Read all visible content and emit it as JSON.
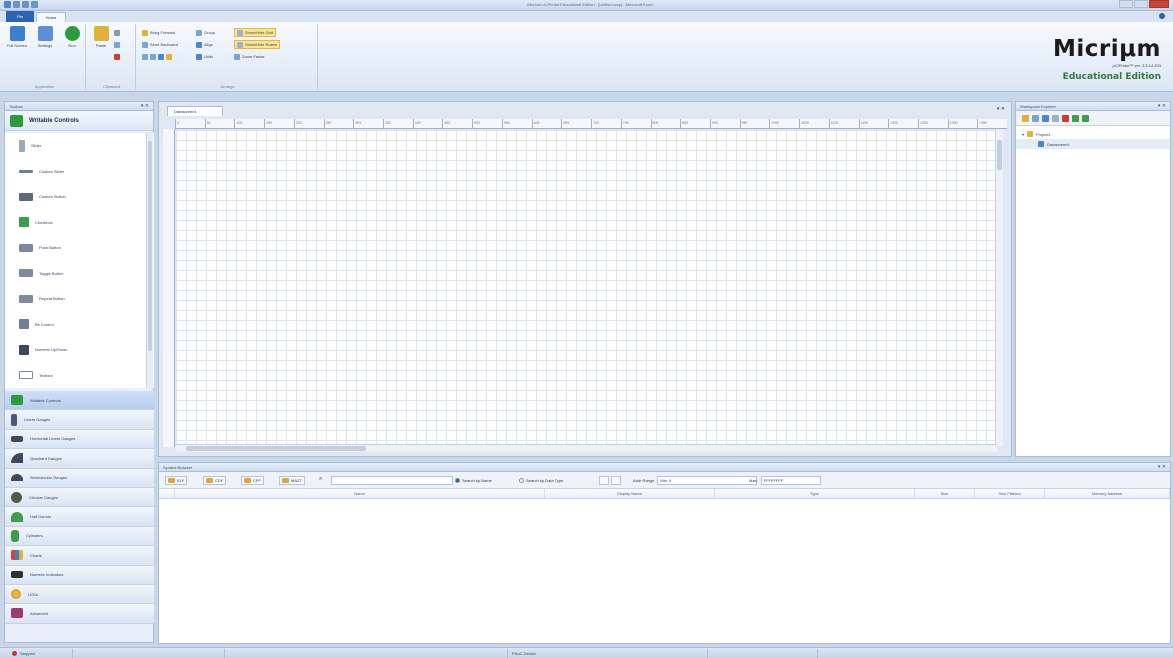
{
  "window": {
    "title": "Micrium uC/Probe Educational Edition - [Untitled.wsp] - Microsoft Excel"
  },
  "ribbon": {
    "tabs": [
      {
        "label": "File"
      },
      {
        "label": "Home"
      }
    ],
    "groups": {
      "application": {
        "label": "Application",
        "full_screen": "Full Screen",
        "settings": "Settings",
        "run": "Run"
      },
      "clipboard": {
        "label": "Clipboard",
        "paste": "Paste"
      },
      "arrange": {
        "label": "Arrange",
        "bring_forward": "Bring Forward",
        "send_backward": "Send Backward",
        "group": "Group",
        "align": "Align",
        "units": "Units",
        "show_grid": "Show/Hide Grid",
        "show_rulers": "Show/Hide Rulers",
        "zoom_factor": "Zoom Factor"
      }
    }
  },
  "brand": {
    "name": "Micriμm",
    "version": "μC/Probe™ ver. 3.5.14.203",
    "edition": "Educational Edition"
  },
  "toolbox": {
    "title": "Toolbox",
    "current_category": "Writable Controls",
    "items": [
      {
        "label": "Slider"
      },
      {
        "label": "Custom Slider"
      },
      {
        "label": "Custom Switch"
      },
      {
        "label": "Checkbox"
      },
      {
        "label": "Push Button"
      },
      {
        "label": "Toggle Button"
      },
      {
        "label": "Repeat Button"
      },
      {
        "label": "Bit Control"
      },
      {
        "label": "Numeric Up/Down"
      },
      {
        "label": "Textbox"
      }
    ],
    "categories": [
      {
        "label": "Writable Controls"
      },
      {
        "label": "Linear Gauges"
      },
      {
        "label": "Horizontal Linear Gauges"
      },
      {
        "label": "Quadrant Gauges"
      },
      {
        "label": "Semicircular Gauges"
      },
      {
        "label": "Circular Gauges"
      },
      {
        "label": "Half Donuts"
      },
      {
        "label": "Cylinders"
      },
      {
        "label": "Charts"
      },
      {
        "label": "Numeric Indicators"
      },
      {
        "label": "LEDs"
      },
      {
        "label": "Advanced"
      }
    ]
  },
  "designer": {
    "tab": "Datascreen1",
    "ruler_ticks": [
      "0",
      "50",
      "100",
      "150",
      "200",
      "250",
      "300",
      "350",
      "400",
      "450",
      "500",
      "550",
      "600",
      "650",
      "700",
      "750",
      "800",
      "850",
      "900",
      "950",
      "1000",
      "1050",
      "1100",
      "1150",
      "1200",
      "1250",
      "1300",
      "1350"
    ]
  },
  "explorer": {
    "title": "Workspace Explorer",
    "tree": [
      {
        "label": "Project1"
      },
      {
        "label": "Datascreen1"
      }
    ]
  },
  "symbols": {
    "title": "Symbol Browser",
    "buttons": [
      "ELF",
      "CDF",
      "CFF",
      "MAZT"
    ],
    "search_by_name": "Search by Name",
    "search_by_type": "Search by Data Type",
    "addr_range_label": "Addr Range",
    "addr_min_label": "Min:",
    "addr_min_value": "0",
    "addr_max_label": "Max:",
    "addr_max_value": "FFFFFFFF",
    "columns": [
      "Name",
      "Display Name",
      "Type",
      "Size",
      "Size Filtered",
      "Memory Address"
    ]
  },
  "status": {
    "state": "Stopped",
    "device": "PSoC Device"
  },
  "colors": {
    "accent": "#2b63b3",
    "brand_edition": "#2f7a3b",
    "toggle_active": "#fde58f"
  }
}
